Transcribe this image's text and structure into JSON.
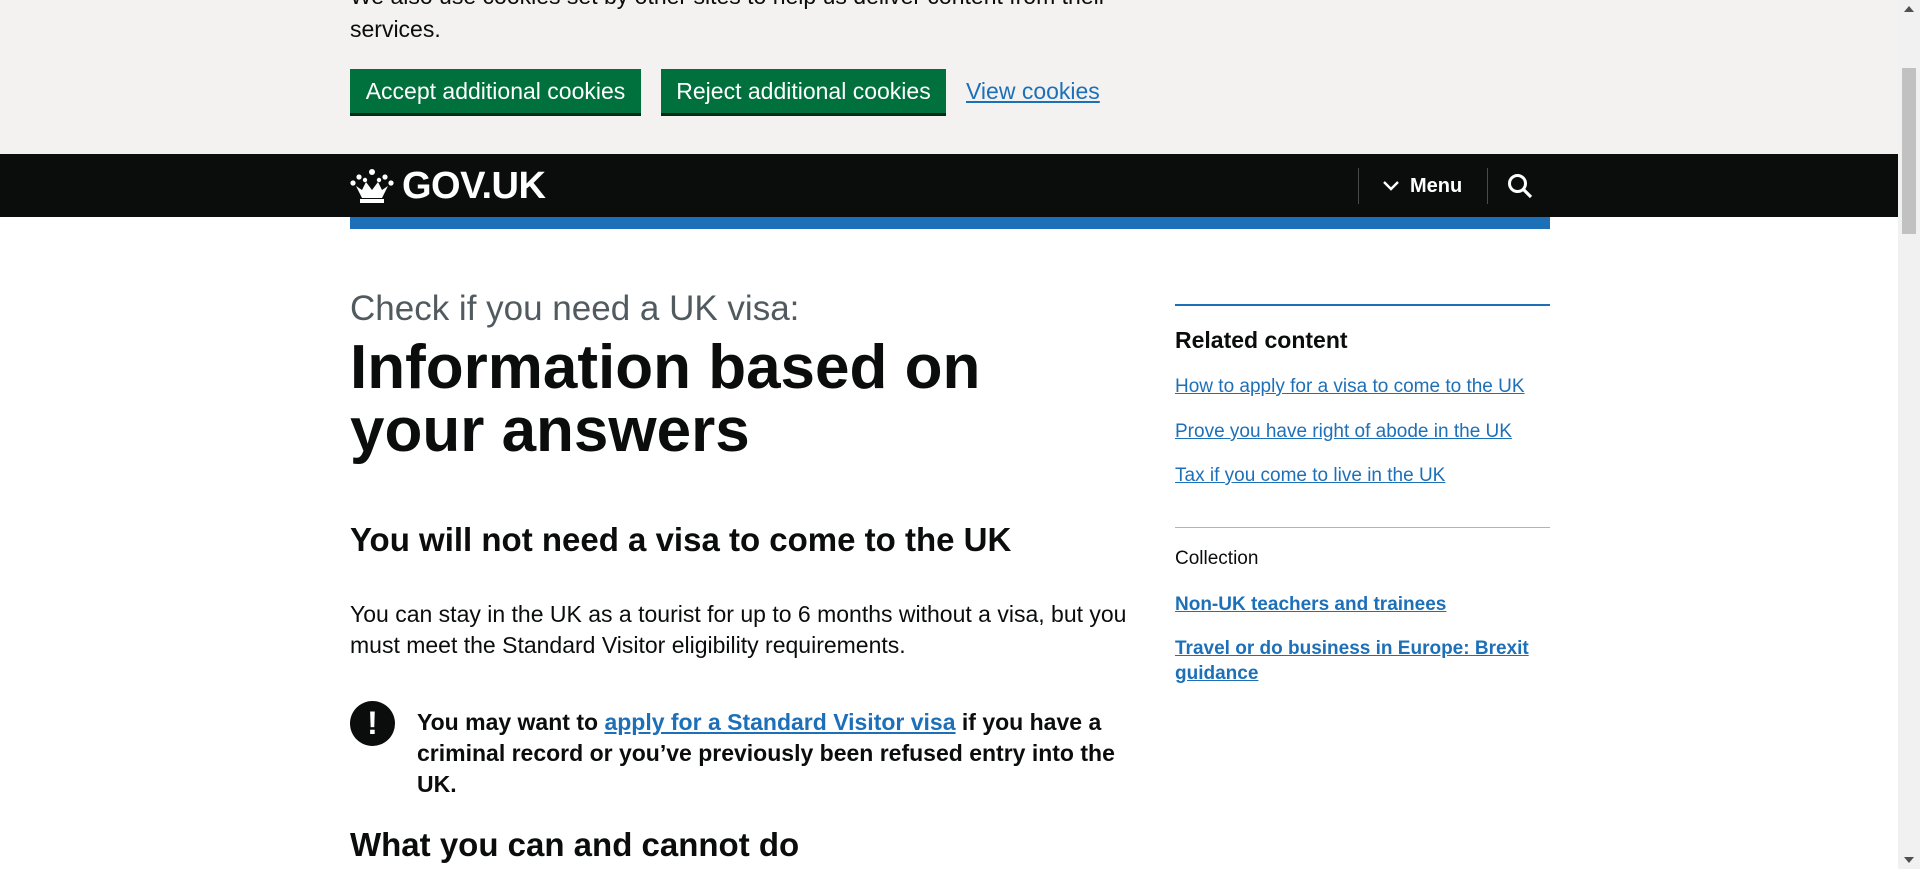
{
  "cookie_banner": {
    "text_line1": "We also use cookies set by other sites to help us deliver content from their",
    "text_line2": "services.",
    "accept_label": "Accept additional cookies",
    "reject_label": "Reject additional cookies",
    "view_label": "View cookies"
  },
  "header": {
    "logo_text": "GOV.UK",
    "menu_label": "Menu",
    "icons": {
      "crown": "crown-icon",
      "menu": "chevron-down-icon",
      "search": "search-icon"
    }
  },
  "main": {
    "caption": "Check if you need a UK visa:",
    "title": "Information based on your answers",
    "heading1": "You will not need a visa to come to the UK",
    "body": "You can stay in the UK as a tourist for up to 6 months without a visa, but you must meet the Standard Visitor eligibility requirements.",
    "warning": {
      "icon_glyph": "!",
      "prefix": "You may want to ",
      "link": "apply for a Standard Visitor visa",
      "suffix": " if you have a criminal record or you’ve previously been refused entry into the UK."
    },
    "heading2": "What you can and cannot do"
  },
  "sidebar": {
    "related_heading": "Related content",
    "related_links": [
      "How to apply for a visa to come to the UK",
      "Prove you have right of abode in the UK",
      "Tax if you come to live in the UK"
    ],
    "collection_label": "Collection",
    "collection_links": [
      "Non-UK teachers and trainees",
      "Travel or do business in Europe: Brexit guidance"
    ]
  },
  "colors": {
    "brand_black": "#0b0c0c",
    "button_green": "#00703c",
    "link_blue": "#1d70b8",
    "banner_grey": "#f3f2f1"
  }
}
